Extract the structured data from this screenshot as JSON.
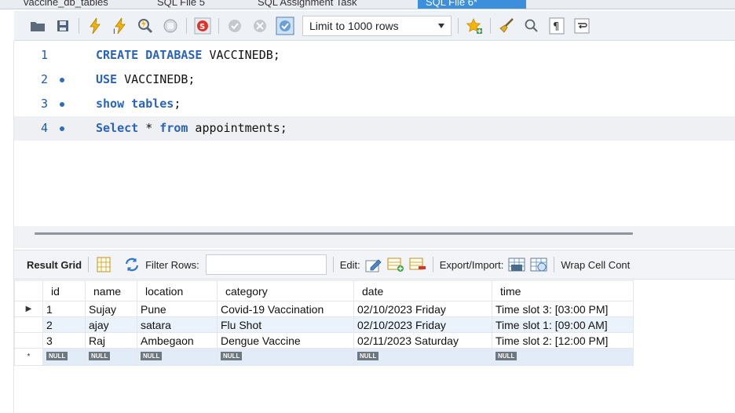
{
  "tabs": [
    {
      "label": "vaccine_db_tables"
    },
    {
      "label": "SQL File 5"
    },
    {
      "label": "SQL Assignment Task"
    },
    {
      "label": "SQL File 6*"
    }
  ],
  "toolbar": {
    "limit_label": "Limit to 1000 rows"
  },
  "editor": {
    "lines": [
      {
        "number": "1",
        "marker": false,
        "keyword": "CREATE DATABASE",
        "rest": " VACCINEDB;"
      },
      {
        "number": "2",
        "marker": true,
        "keyword": "USE",
        "rest": " VACCINEDB;"
      },
      {
        "number": "3",
        "marker": true,
        "keyword": "show tables",
        "rest": ";"
      },
      {
        "number": "4",
        "marker": true,
        "keyword": "Select",
        "mid": " * ",
        "keyword2": "from",
        "rest": " appointments;"
      }
    ]
  },
  "result_toolbar": {
    "result_grid_label": "Result Grid",
    "filter_rows_label": "Filter Rows:",
    "filter_value": "",
    "edit_label": "Edit:",
    "export_import_label": "Export/Import:",
    "wrap_label": "Wrap Cell Cont"
  },
  "grid": {
    "columns": [
      "id",
      "name",
      "location",
      "category",
      "date",
      "time"
    ],
    "rows": [
      {
        "id": "1",
        "name": "Sujay",
        "location": "Pune",
        "category": "Covid-19 Vaccination",
        "date": "02/10/2023 Friday",
        "time": "Time slot 3: [03:00 PM]"
      },
      {
        "id": "2",
        "name": "ajay",
        "location": "satara",
        "category": "Flu Shot",
        "date": "02/10/2023 Friday",
        "time": "Time slot 1: [09:00 AM]"
      },
      {
        "id": "3",
        "name": "Raj",
        "location": "Ambegaon",
        "category": "Dengue Vaccine",
        "date": "02/11/2023 Saturday",
        "time": "Time slot 2: [12:00 PM]"
      }
    ],
    "null_label": "NULL",
    "new_row_marker": "*",
    "current_row_marker": "▶"
  },
  "colors": {
    "keyword": "#2a63b8",
    "active_tab": "#3b8fdb",
    "row_alt": "#eaf3fc"
  }
}
